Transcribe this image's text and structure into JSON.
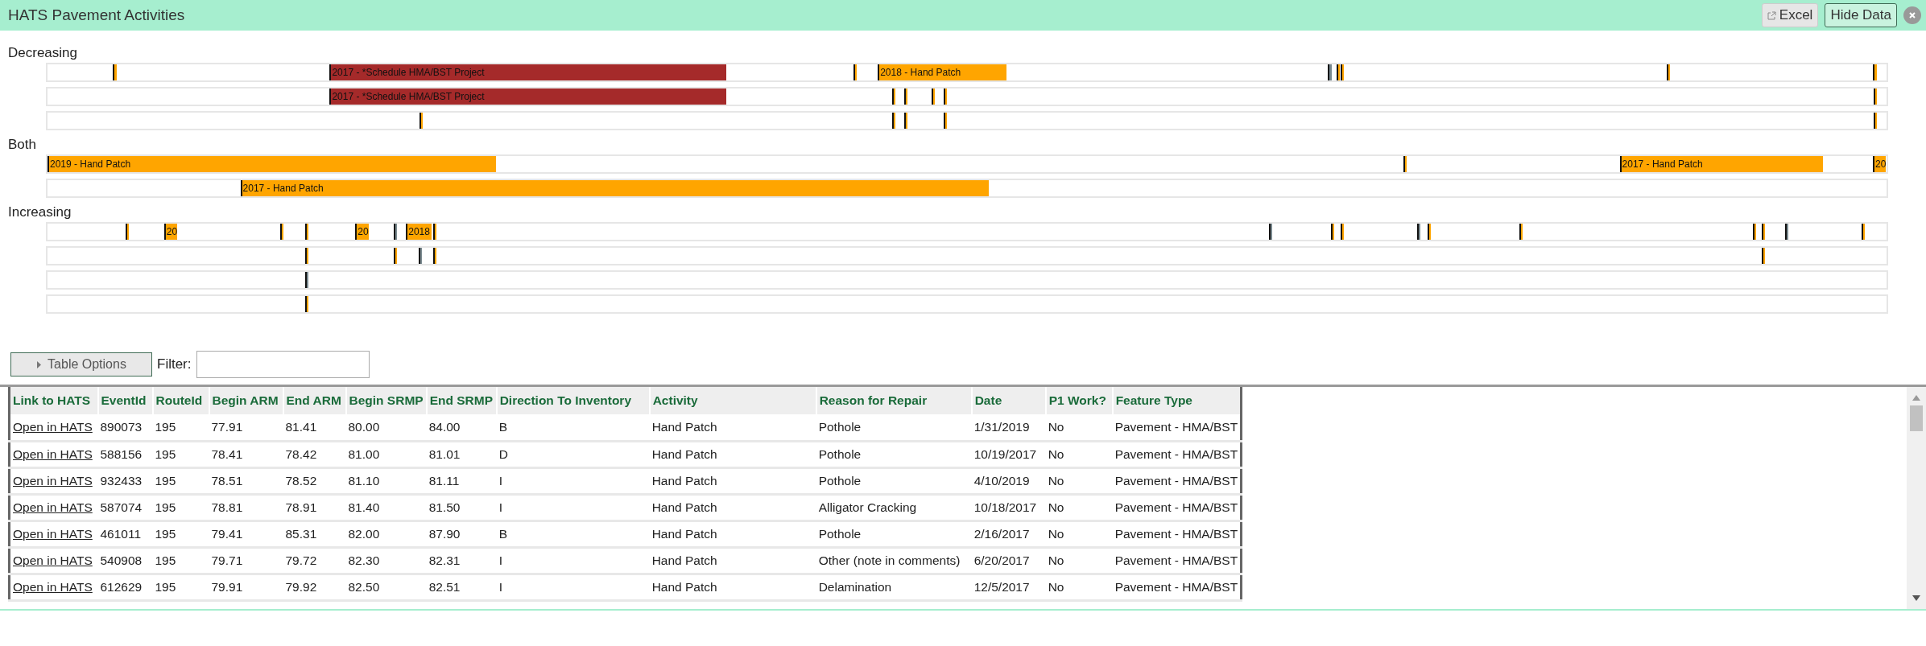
{
  "header": {
    "title": "HATS Pavement Activities",
    "buttons": [
      {
        "label": "Excel",
        "kind": "export",
        "selected": false
      },
      {
        "label": "Hide Data",
        "kind": "toggle",
        "selected": true
      }
    ]
  },
  "timeline": [
    {
      "label": "Decreasing",
      "tracks": [
        {
          "items": [
            {
              "color": "#ffa500"
            },
            {
              "color": "#a52a2a",
              "label": "2017 - *Schedule HMA/BST Project"
            },
            {
              "color": "#ffa500"
            },
            {
              "color": "#ffa500",
              "label": "2018 - Hand Patch"
            },
            {
              "color": "#7a8a90"
            },
            {
              "color": "#ffa500"
            },
            {
              "color": "#ffa500"
            },
            {
              "color": "#ffa500"
            },
            {
              "color": "#ffa500"
            }
          ]
        },
        {
          "items": [
            {
              "color": "#a52a2a",
              "label": "2017 - *Schedule HMA/BST Project"
            },
            {
              "color": "#ffa500"
            },
            {
              "color": "#ffa500"
            },
            {
              "color": "#ffa500"
            },
            {
              "color": "#ffa500"
            },
            {
              "color": "#ffa500"
            }
          ]
        },
        {
          "items": [
            {
              "color": "#ffa500"
            },
            {
              "color": "#ffa500"
            },
            {
              "color": "#ffa500"
            },
            {
              "color": "#ffa500"
            },
            {
              "color": "#ffa500"
            }
          ]
        }
      ]
    },
    {
      "label": "Both",
      "tracks": [
        {
          "items": [
            {
              "color": "#ffa500",
              "label": "2019 - Hand Patch"
            },
            {
              "color": "#ffa500"
            },
            {
              "color": "#ffa500",
              "label": "2017 - Hand Patch"
            },
            {
              "color": "#ffa500",
              "label": "20"
            }
          ]
        },
        {
          "items": [
            {
              "color": "#ffa500",
              "label": "2017 - Hand Patch"
            }
          ]
        }
      ]
    },
    {
      "label": "Increasing",
      "tracks": [
        {
          "items": [
            {
              "color": "#ffa500"
            },
            {
              "color": "#ffa500",
              "label": "20"
            },
            {
              "color": "#ffa500"
            },
            {
              "color": "#ffa500"
            },
            {
              "color": "#ffa500",
              "label": "20"
            },
            {
              "color": "#7a8a90"
            },
            {
              "color": "#ffa500",
              "label": "2018"
            },
            {
              "color": "#ffa500"
            },
            {
              "color": "#7a8a90"
            },
            {
              "color": "#ffa500"
            },
            {
              "color": "#ffa500"
            },
            {
              "color": "#7a8a90"
            },
            {
              "color": "#ffa500"
            },
            {
              "color": "#ffa500"
            },
            {
              "color": "#ffa500"
            },
            {
              "color": "#ffa500"
            },
            {
              "color": "#7a8a90"
            },
            {
              "color": "#ffa500"
            }
          ]
        },
        {
          "items": [
            {
              "color": "#ffa500"
            },
            {
              "color": "#ffa500"
            },
            {
              "color": "#7a8a90"
            },
            {
              "color": "#ffa500"
            },
            {
              "color": "#ffa500"
            }
          ]
        },
        {
          "items": [
            {
              "color": "#7a8a90"
            }
          ]
        },
        {
          "items": [
            {
              "color": "#ffa500"
            }
          ]
        }
      ]
    }
  ],
  "table_options": {
    "button": "Table Options",
    "expanded": false,
    "filter_label": "Filter:"
  },
  "table": {
    "columns": [
      "Link to HATS",
      "EventId",
      "RouteId",
      "Begin ARM",
      "End ARM",
      "Begin SRMP",
      "End SRMP",
      "Direction To Inventory",
      "Activity",
      "Reason for Repair",
      "Date",
      "P1 Work?",
      "Feature Type"
    ],
    "rows": [
      [
        "Open in HATS",
        "890073",
        "195",
        "77.91",
        "81.41",
        "80.00",
        "84.00",
        "B",
        "Hand Patch",
        "Pothole",
        "1/31/2019",
        "No",
        "Pavement - HMA/BST"
      ],
      [
        "Open in HATS",
        "588156",
        "195",
        "78.41",
        "78.42",
        "81.00",
        "81.01",
        "D",
        "Hand Patch",
        "Pothole",
        "10/19/2017",
        "No",
        "Pavement - HMA/BST"
      ],
      [
        "Open in HATS",
        "932433",
        "195",
        "78.51",
        "78.52",
        "81.10",
        "81.11",
        "I",
        "Hand Patch",
        "Pothole",
        "4/10/2019",
        "No",
        "Pavement - HMA/BST"
      ],
      [
        "Open in HATS",
        "587074",
        "195",
        "78.81",
        "78.91",
        "81.40",
        "81.50",
        "I",
        "Hand Patch",
        "Alligator Cracking",
        "10/18/2017",
        "No",
        "Pavement - HMA/BST"
      ],
      [
        "Open in HATS",
        "461011",
        "195",
        "79.41",
        "85.31",
        "82.00",
        "87.90",
        "B",
        "Hand Patch",
        "Pothole",
        "2/16/2017",
        "No",
        "Pavement - HMA/BST"
      ],
      [
        "Open in HATS",
        "540908",
        "195",
        "79.71",
        "79.72",
        "82.30",
        "82.31",
        "I",
        "Hand Patch",
        "Other (note in comments)",
        "6/20/2017",
        "No",
        "Pavement - HMA/BST"
      ],
      [
        "Open in HATS",
        "612629",
        "195",
        "79.91",
        "79.92",
        "82.50",
        "82.51",
        "I",
        "Hand Patch",
        "Delamination",
        "12/5/2017",
        "No",
        "Pavement - HMA/BST"
      ]
    ]
  }
}
